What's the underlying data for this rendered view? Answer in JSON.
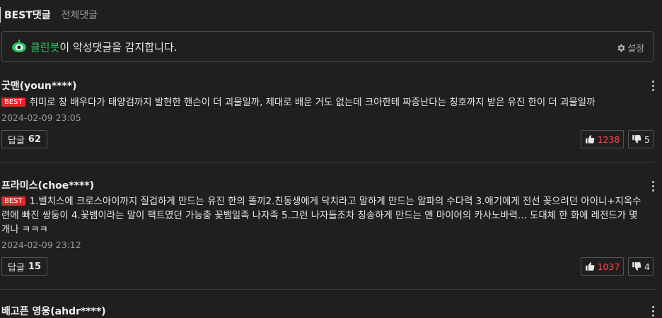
{
  "tabs": {
    "best": "BEST댓글",
    "all": "전체댓글"
  },
  "cleanbot": {
    "name": "클린봇",
    "text": "이 악성댓글을 감지합니다.",
    "settings": "설정"
  },
  "comments": [
    {
      "author": "굿맨(youn****)",
      "badge": "BEST",
      "text": "취미로 창 배우다가 태양검까지 발현한 핸슨이 더 괴물일까, 제대로 배운 거도 없는데 크아한테 짜증난다는 칭호까지 받은 유진 한이 더 괴물일까",
      "date": "2024-02-09 23:05",
      "reply_label": "답글",
      "reply_count": "62",
      "likes": "1238",
      "dislikes": "5"
    },
    {
      "author": "프라미스(choe****)",
      "badge": "BEST",
      "text": "1.벨치스에 크로스아이까지 질겁하게 만드는 유진 한의 똘끼2.친동생에게 닥치라고 말하게 만드는 알파의 수다력 3.애기에게 전선 꽂으려던 아이니+지옥수련에 빠진 쌍둥이 4.꽃뱀이라는 말이 팩트였던 가능충 꽃뱀일족 나자족 5.그런 나자들조차 칭송하게 만드는 앤 마이어의 카사노바력... 도대체 한 화에 레전드가 몇 개나 ㅋㅋㅋ",
      "date": "2024-02-09 23:12",
      "reply_label": "답글",
      "reply_count": "15",
      "likes": "1037",
      "dislikes": "4"
    },
    {
      "author": "배고픈 영웅(ahdr****)"
    }
  ]
}
